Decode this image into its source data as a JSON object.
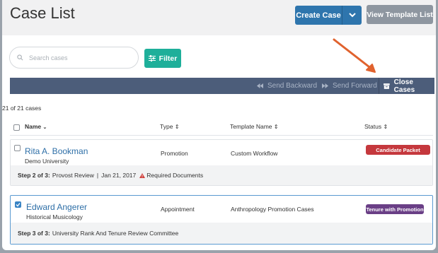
{
  "header": {
    "title": "Case List",
    "create_case_label": "Create Case",
    "view_template_list_label": "View Template List"
  },
  "search": {
    "placeholder": "Search cases"
  },
  "filter_label": "Filter",
  "toolbar": {
    "send_backward": "Send Backward",
    "send_forward": "Send Forward",
    "close_cases": "Close Cases"
  },
  "case_count": "21 of 21 cases",
  "columns": {
    "name": "Name",
    "type": "Type",
    "template_name": "Template Name",
    "status": "Status"
  },
  "cases": [
    {
      "name": "Rita A. Bookman",
      "org": "Demo University",
      "type": "Promotion",
      "template": "Custom Workflow",
      "status": "Candidate Packet",
      "status_color": "#c5383d",
      "checked": false,
      "step_label": "Step 2 of 3:",
      "step_text": "Provost Review",
      "date": "Jan 21, 2017",
      "warning": "Required Documents"
    },
    {
      "name": "Edward Angerer",
      "org": "Historical Musicology",
      "type": "Appointment",
      "template": "Anthropology Promotion Cases",
      "status": "Tenure with Promotion",
      "status_color": "#6a3f86",
      "checked": true,
      "step_label": "Step 3 of 3:",
      "step_text": "University Rank And Tenure Review Committee"
    }
  ],
  "colors": {
    "primary": "#2e75ad",
    "teal": "#1eaf9a",
    "toolbar": "#4c5d7a",
    "annotation_arrow": "#e0622e"
  }
}
